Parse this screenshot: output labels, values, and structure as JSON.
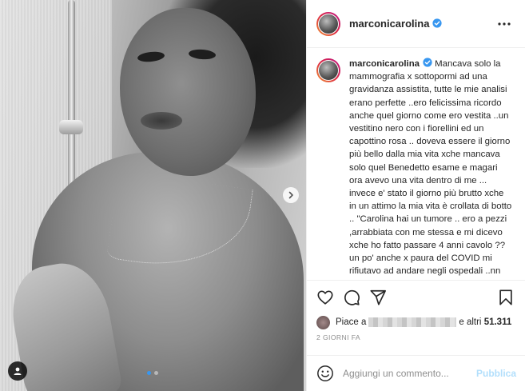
{
  "post": {
    "username": "marconicarolina",
    "verified": true,
    "caption": "Mancava solo la mammografia x sottopormi ad una gravidanza assistita, tutte le mie analisi erano perfette ..ero felicissima ricordo anche quel giorno come ero vestita ..un vestitino nero con i fiorellini ed un capottino rosa .. doveva essere il giorno più bello dalla mia vita xche mancava solo quel Benedetto esame e magari ora avevo una vita dentro di me ... invece e' stato il giorno più brutto xche in un attimo la mia vita è crollata di botto .. \"Carolina hai un tumore .. ero a pezzi ,arrabbiata con me stessa e mi dicevo xche ho fatto passare 4 anni cavolo ??un po' anche x paura del COVID mi rifiutavo ad andare negli ospedali ..nn ho fatto prevenzione e magari tutto questo nn capitava .... invece sto affrontando la",
    "likes_prefix": "Piace a",
    "likes_suffix": "e altri",
    "likes_count": "51.311",
    "date": "2 GIORNI FA"
  },
  "comment": {
    "placeholder": "Aggiungi un commento...",
    "post_label": "Pubblica"
  },
  "carousel": {
    "slides": 2,
    "active": 0
  },
  "icons": {
    "header_more": "more-horizontal-icon",
    "like": "heart-icon",
    "comment": "comment-icon",
    "share": "send-icon",
    "save": "bookmark-icon",
    "emoji": "emoji-icon",
    "next": "chevron-right-icon",
    "tag": "user-tag-icon",
    "verified": "verified-badge-icon"
  },
  "colors": {
    "verified": "#3897f0",
    "post_disabled": "#b2dffc",
    "muted": "#8e8e8e",
    "text": "#262626"
  }
}
